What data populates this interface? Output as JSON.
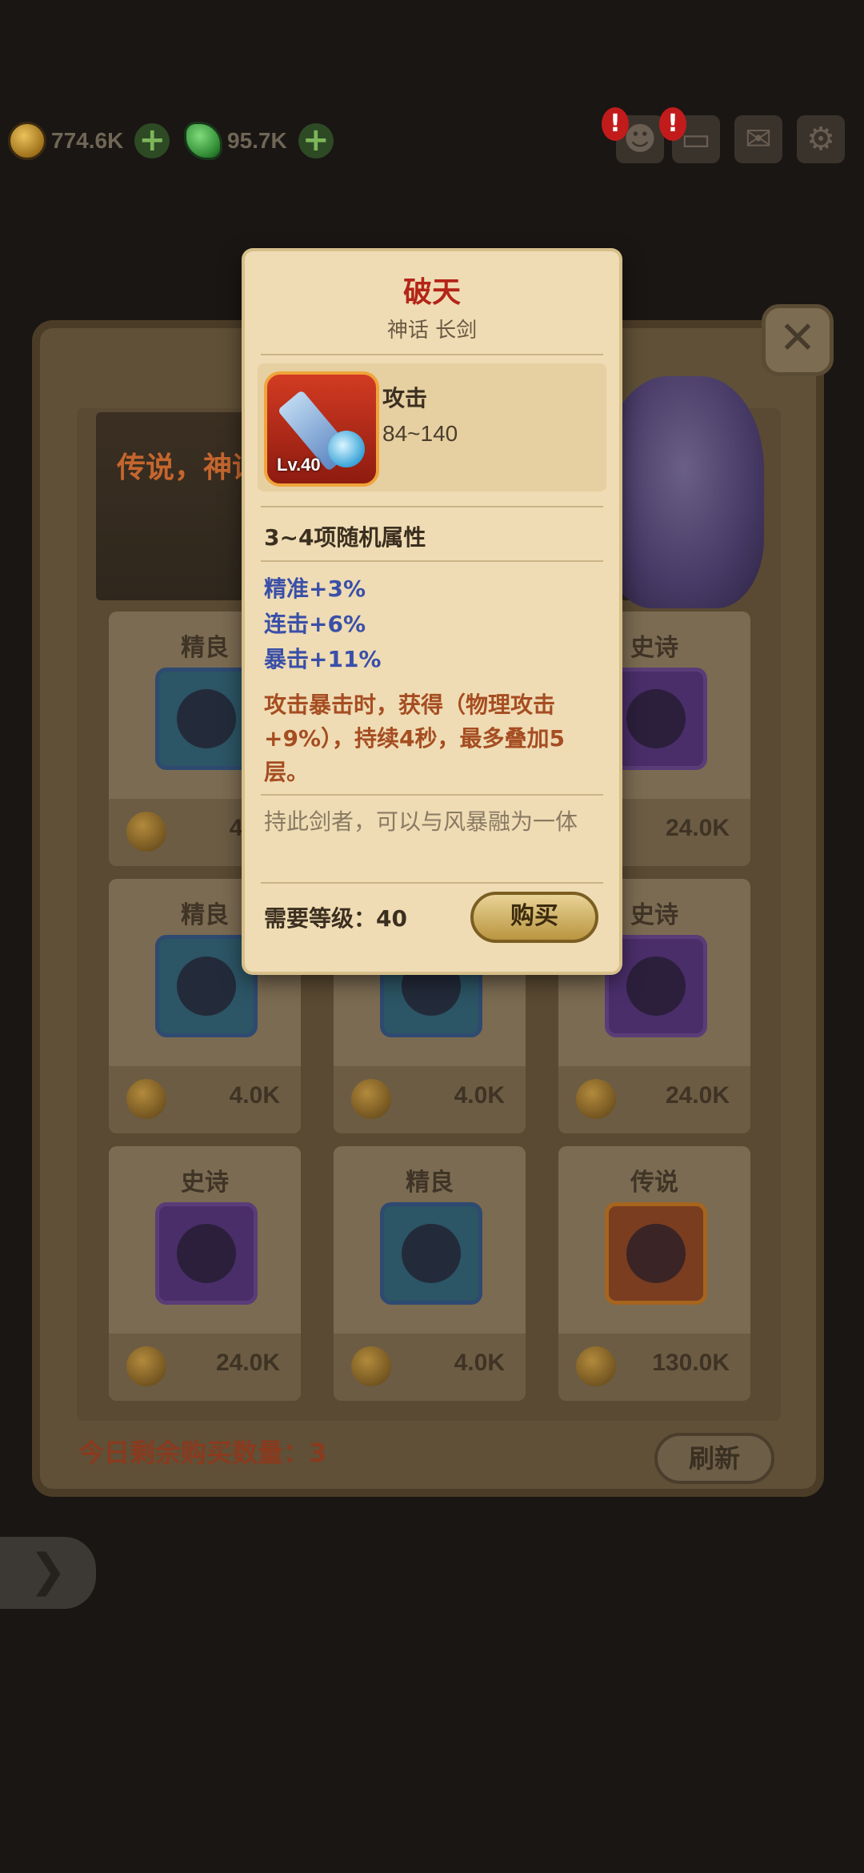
{
  "resources": {
    "gold": "774.6K",
    "jade": "95.7K"
  },
  "colors": {
    "legend_red": "#b42418",
    "attr_blue": "#3a4fa8",
    "effect_orange": "#a64d22"
  },
  "shop": {
    "banner_text": "传说，神话",
    "remaining_label": "今日剩余购买数量：3",
    "refresh_label": "刷新",
    "cards": [
      {
        "rarity": "精良",
        "price": "4.0K",
        "slot": "fine",
        "icon": "gloves-icon"
      },
      {
        "rarity": "",
        "price": "",
        "slot": "",
        "icon": ""
      },
      {
        "rarity": "史诗",
        "price": "24.0K",
        "slot": "epic",
        "icon": "staff-icon"
      },
      {
        "rarity": "精良",
        "price": "4.0K",
        "slot": "fine",
        "icon": "boots-icon"
      },
      {
        "rarity": "",
        "price": "4.0K",
        "slot": "fine",
        "icon": "ring-icon"
      },
      {
        "rarity": "史诗",
        "price": "24.0K",
        "slot": "epic",
        "icon": "armor-icon"
      },
      {
        "rarity": "史诗",
        "price": "24.0K",
        "slot": "epic",
        "icon": "orb-icon"
      },
      {
        "rarity": "精良",
        "price": "4.0K",
        "slot": "fine",
        "icon": "skull-ring-icon"
      },
      {
        "rarity": "传说",
        "price": "130.0K",
        "slot": "leg",
        "icon": "blade-icon"
      }
    ]
  },
  "popup": {
    "title": "破天",
    "subtitle": "神话 长剑",
    "level": "Lv.40",
    "stat_name": "攻击",
    "stat_value": "84~140",
    "random_attrs": "3~4项随机属性",
    "attrs": [
      "精准+3%",
      "连击+6%",
      "暴击+11%"
    ],
    "effect": "攻击暴击时，获得（物理攻击+9%），持续4秒，最多叠加5层。",
    "flavor": "持此剑者，可以与风暴融为一体",
    "requirement": "需要等级：40",
    "buy_label": "购买"
  }
}
